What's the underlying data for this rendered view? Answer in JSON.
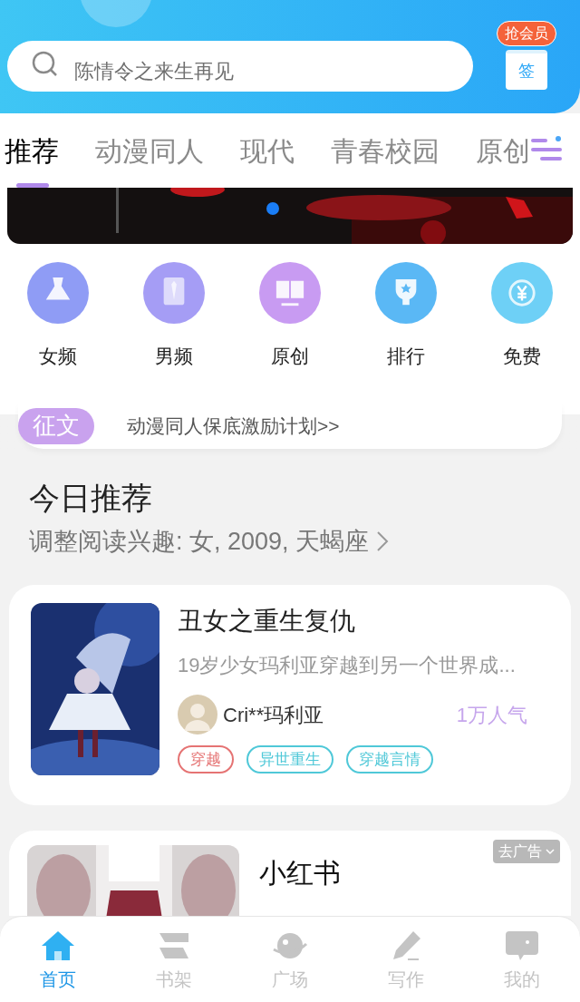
{
  "header": {
    "search": {
      "placeholder": "陈情令之来生再见"
    },
    "gift": {
      "badge": "抢会员",
      "label": "签"
    }
  },
  "tabs": [
    {
      "label": "推荐",
      "selected": true
    },
    {
      "label": "动漫同人",
      "selected": false
    },
    {
      "label": "现代",
      "selected": false
    },
    {
      "label": "青春校园",
      "selected": false
    },
    {
      "label": "原创",
      "selected": false
    }
  ],
  "categories": [
    {
      "kind": "dress",
      "label": "女频",
      "color": "#8f9cf5"
    },
    {
      "kind": "shirt",
      "label": "男频",
      "color": "#a59df5"
    },
    {
      "kind": "book",
      "label": "原创",
      "color": "#c89bf2"
    },
    {
      "kind": "trophy",
      "label": "排行",
      "color": "#5ab8f5"
    },
    {
      "kind": "coin",
      "label": "免费",
      "color": "#6ed0f6"
    }
  ],
  "notice": {
    "tag": "征文",
    "text": "动漫同人保底激励计划>>"
  },
  "section": {
    "title": "今日推荐",
    "subtitle": "调整阅读兴趣: 女, 2009, 天蝎座"
  },
  "book": {
    "title": "丑女之重生复仇",
    "description": "19岁少女玛利亚穿越到另一个世界成...",
    "author": "Cri**玛利亚",
    "popularity": "1万人气",
    "tags": [
      {
        "label": "穿越",
        "color": "#e57373"
      },
      {
        "label": "异世重生",
        "color": "#4fc8d8"
      },
      {
        "label": "穿越言情",
        "color": "#4fc8d8"
      }
    ]
  },
  "ad": {
    "title": "小红书",
    "remove": "去广告"
  },
  "nav": [
    {
      "kind": "home",
      "label": "首页",
      "selected": true
    },
    {
      "kind": "shelf",
      "label": "书架",
      "selected": false
    },
    {
      "kind": "planet",
      "label": "广场",
      "selected": false
    },
    {
      "kind": "pen",
      "label": "写作",
      "selected": false
    },
    {
      "kind": "chat",
      "label": "我的",
      "selected": false
    }
  ]
}
